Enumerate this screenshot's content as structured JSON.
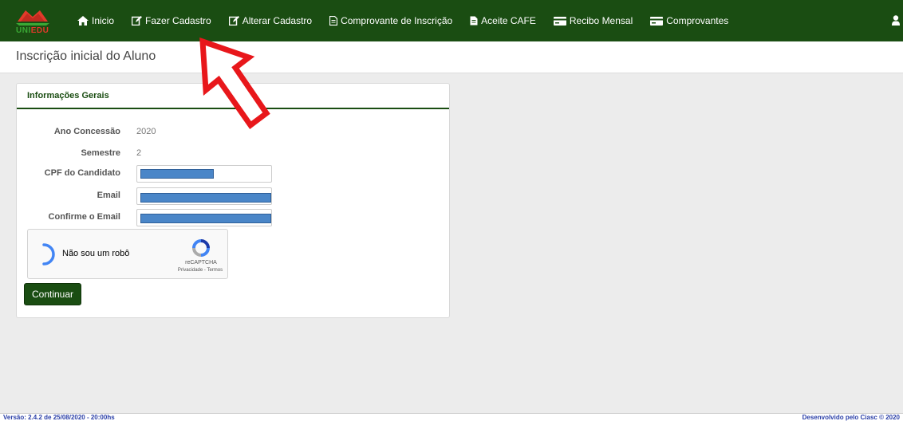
{
  "navbar": {
    "logo_text_a": "UNI",
    "logo_text_b": "EDU",
    "items": [
      {
        "label": "Inicio",
        "icon": "home-icon"
      },
      {
        "label": "Fazer Cadastro",
        "icon": "edit-icon"
      },
      {
        "label": "Alterar Cadastro",
        "icon": "edit-icon"
      },
      {
        "label": "Comprovante de Inscrição",
        "icon": "document-icon"
      },
      {
        "label": "Aceite CAFE",
        "icon": "document-icon"
      },
      {
        "label": "Recibo Mensal",
        "icon": "card-icon"
      },
      {
        "label": "Comprovantes",
        "icon": "card-icon"
      }
    ],
    "user_icon": "user-icon"
  },
  "page": {
    "title": "Inscrição inicial do Aluno"
  },
  "panel": {
    "header": "Informações Gerais",
    "fields": {
      "ano_label": "Ano Concessão",
      "ano_value": "2020",
      "semestre_label": "Semestre",
      "semestre_value": "2",
      "cpf_label": "CPF do Candidato",
      "email_label": "Email",
      "confirm_label": "Confirme o Email"
    },
    "recaptcha": {
      "label": "Não sou um robô",
      "brand": "reCAPTCHA",
      "links": "Privacidade - Termos"
    },
    "continue_label": "Continuar"
  },
  "footer": {
    "version": "Versão: 2.4.2 de 25/08/2020 - 20:00hs",
    "credit": "Desenvolvido pelo Ciasc © 2020"
  },
  "colors": {
    "nav_bg": "#1a4d12",
    "accent": "#1a4d12",
    "redact": "#4a86c8",
    "arrow": "#e8171b"
  }
}
